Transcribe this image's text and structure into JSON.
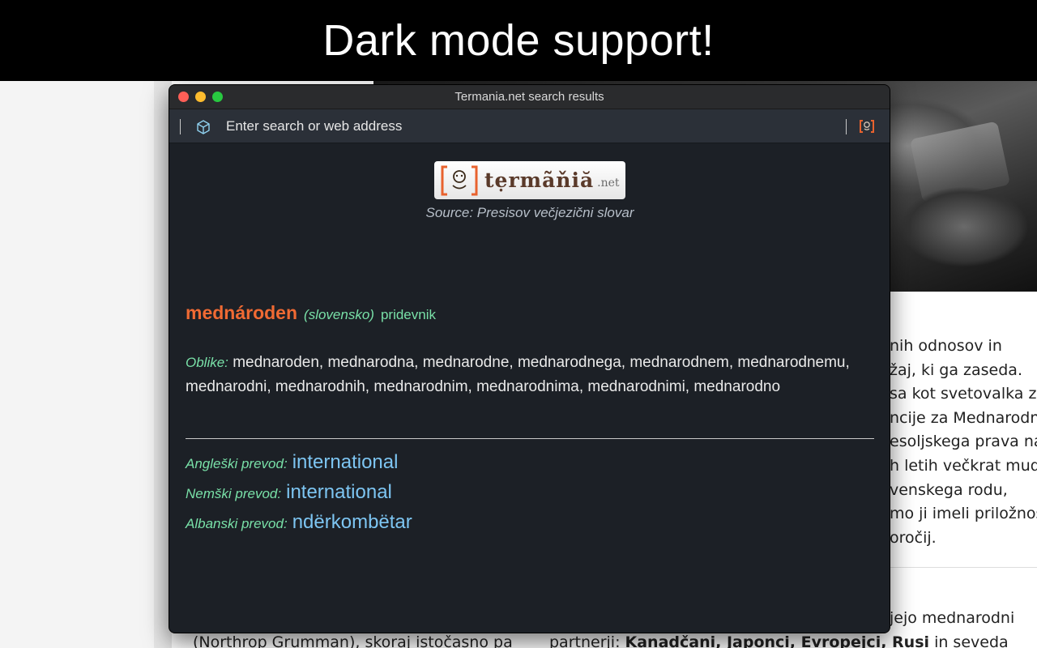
{
  "banner": {
    "text": "Dark mode support!"
  },
  "background_page": {
    "right_lines": [
      "nih odnosov in",
      "žaj, ki ga zaseda.",
      "sa kot svetovalka za",
      "ncije za Mednarodn",
      "esoljskega prava na",
      "h letih večkrat mudi",
      "venskega rodu,",
      "mo ji imeli priložnost",
      "oročij."
    ],
    "mid_right": "jejo mednarodni",
    "bottom_left": "(Northrop Grumman), skoraj istočasno pa",
    "bottom_right_prefix": "partnerji: ",
    "bottom_right_bold": "Kanadčani, Japonci, Evropejci, Rusi",
    "bottom_right_suffix": " in seveda"
  },
  "window": {
    "title": "Termania.net search results",
    "toolbar": {
      "address_placeholder": "Enter search or web address"
    },
    "logo": {
      "text": "tẹrmãňiă",
      "suffix": ".net"
    },
    "source": "Source: Presisov večjezični slovar",
    "entry": {
      "headword": "mednároden",
      "language": "(slovensko)",
      "part_of_speech": "pridevnik",
      "forms_label": "Oblike:",
      "forms_text": "mednaroden, mednarodna, mednarodne, mednarodnega, mednarodnem, mednarodnemu, mednarodni, mednarodnih, mednarodnim, mednarodnima, mednarodnimi, mednarodno"
    },
    "translations": [
      {
        "label": "Angleški prevod:",
        "value": "international"
      },
      {
        "label": "Nemški prevod:",
        "value": "international"
      },
      {
        "label": "Albanski prevod:",
        "value": "ndërkombëtar"
      }
    ]
  },
  "colors": {
    "headword": "#f06a33",
    "label_green": "#79e1a8",
    "translation_blue": "#7dc5f2",
    "window_bg": "#1c2026"
  }
}
